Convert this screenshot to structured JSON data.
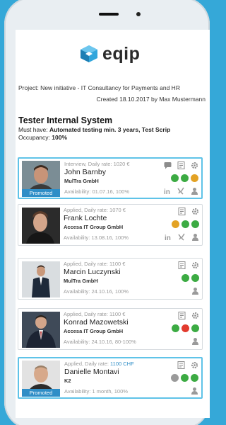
{
  "app": {
    "logo_text": "eqip"
  },
  "project": {
    "line": "Project: New initiative - IT Consultancy for Payments and HR",
    "created": "Created 18.10.2017 by Max Mustermann"
  },
  "system": {
    "title": "Tester Internal System",
    "must_label": "Must have:",
    "must_value": "Automated testing min. 3 years, Test Scrip",
    "occupancy_label": "Occupancy:",
    "occupancy_value": "100%"
  },
  "colors": {
    "green": "#3cab43",
    "orange": "#e3a224",
    "red": "#e23b2e",
    "gray": "#9a9a9a",
    "accent": "#2f8ec7"
  },
  "candidates": [
    {
      "status": "Interview, Daily rate: 1020 €",
      "name": "John Barnby",
      "company": "MulTra GmbH",
      "availability": "Availability: 01.07.16, 100%",
      "promoted": "Promoted",
      "dots": [
        "green",
        "green",
        "orange"
      ]
    },
    {
      "status": "Applied, Daily rate: 1070 €",
      "name": "Frank Lochte",
      "company": "Accesa IT Group GmbH",
      "availability": "Availability: 13.08.16, 100%",
      "dots": [
        "orange",
        "green",
        "green"
      ]
    },
    {
      "status": "Applied, Daily rate: 1100 €",
      "name": "Marcin Luczynski",
      "company": "MulTra GmbH",
      "availability": "Availability: 24.10.16, 100%",
      "dots": [
        "green",
        "green"
      ]
    },
    {
      "status": "Applied, Daily rate: 1100 €",
      "name": "Konrad Mazowetski",
      "company": "Accesa IT Group GmbH",
      "availability": "Availability: 24.10.16, 80-100%",
      "dots": [
        "green",
        "red",
        "green"
      ]
    },
    {
      "status_prefix": "Applied, Daily rate:",
      "status_rate": "1100 CHF",
      "name": "Danielle Montavi",
      "company": "K2",
      "availability": "Availability: 1 month, 100%",
      "promoted": "Promoted",
      "dots": [
        "gray",
        "green",
        "green"
      ]
    }
  ]
}
